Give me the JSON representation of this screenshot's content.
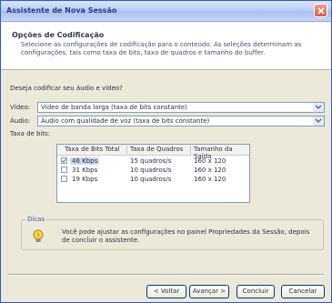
{
  "window": {
    "title": "Assistente de Nova Sessão"
  },
  "header": {
    "title": "Opções de Codificação",
    "description": "Selecione as configurações de codificação para o conteúdo. As seleções determinam as configurações, tais como taxa de bits, taxa de quadros e tamanho do buffer."
  },
  "encode_prompt": "Deseja codificar seu áudio e vídeo?",
  "video": {
    "label": "Vídeo:",
    "value": "Vídeo de banda larga (taxa de bits constante)"
  },
  "audio": {
    "label": "Áudio:",
    "value": "Áudio com qualidade de voz (taxa de bits constante)"
  },
  "bitrate": {
    "label": "Taxa de bits:",
    "columns": [
      "Taxa de Bits Total",
      "Taxa de Quadros",
      "Tamanho da Saída"
    ],
    "rows": [
      {
        "total": "46 Kbps",
        "frames": "15 quadros/s",
        "size": "160 x 120",
        "checked": true
      },
      {
        "total": "31 Kbps",
        "frames": "10 quadros/s",
        "size": "160 x 120",
        "checked": false
      },
      {
        "total": "19 Kbps",
        "frames": "10 quadros/s",
        "size": "160 x 120",
        "checked": false
      }
    ]
  },
  "dicas": {
    "label": "Dicas",
    "text": "Você pode ajustar as configurações no painel Propriedades da Sessão, depois de concluir o assistente."
  },
  "buttons": {
    "back": "< Voltar",
    "next": "Avançar >",
    "finish": "Concluir",
    "cancel": "Cancelar"
  }
}
